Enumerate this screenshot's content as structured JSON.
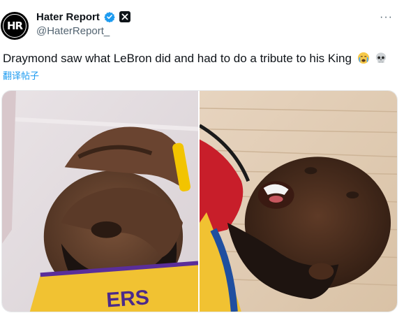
{
  "author": {
    "display_name": "Hater Report",
    "handle": "@HaterReport_",
    "avatar_text": "HR",
    "verified": true,
    "affiliate_badge_icon": "x-logo-icon"
  },
  "header": {
    "more_label": "···"
  },
  "tweet": {
    "text": "Draymond saw what LeBron did and had to do a tribute to his King",
    "emojis": [
      "crying-face-icon",
      "skull-icon"
    ],
    "translate_label": "翻译帖子"
  },
  "media": {
    "images": [
      {
        "icon": "player-hand-on-face-photo",
        "jersey_text": "ERS"
      },
      {
        "icon": "player-lying-on-court-photo"
      }
    ]
  },
  "colors": {
    "verified_blue": "#1d9bf0",
    "text_primary": "#0f1419",
    "text_secondary": "#536471",
    "link_blue": "#1d9bf0"
  }
}
